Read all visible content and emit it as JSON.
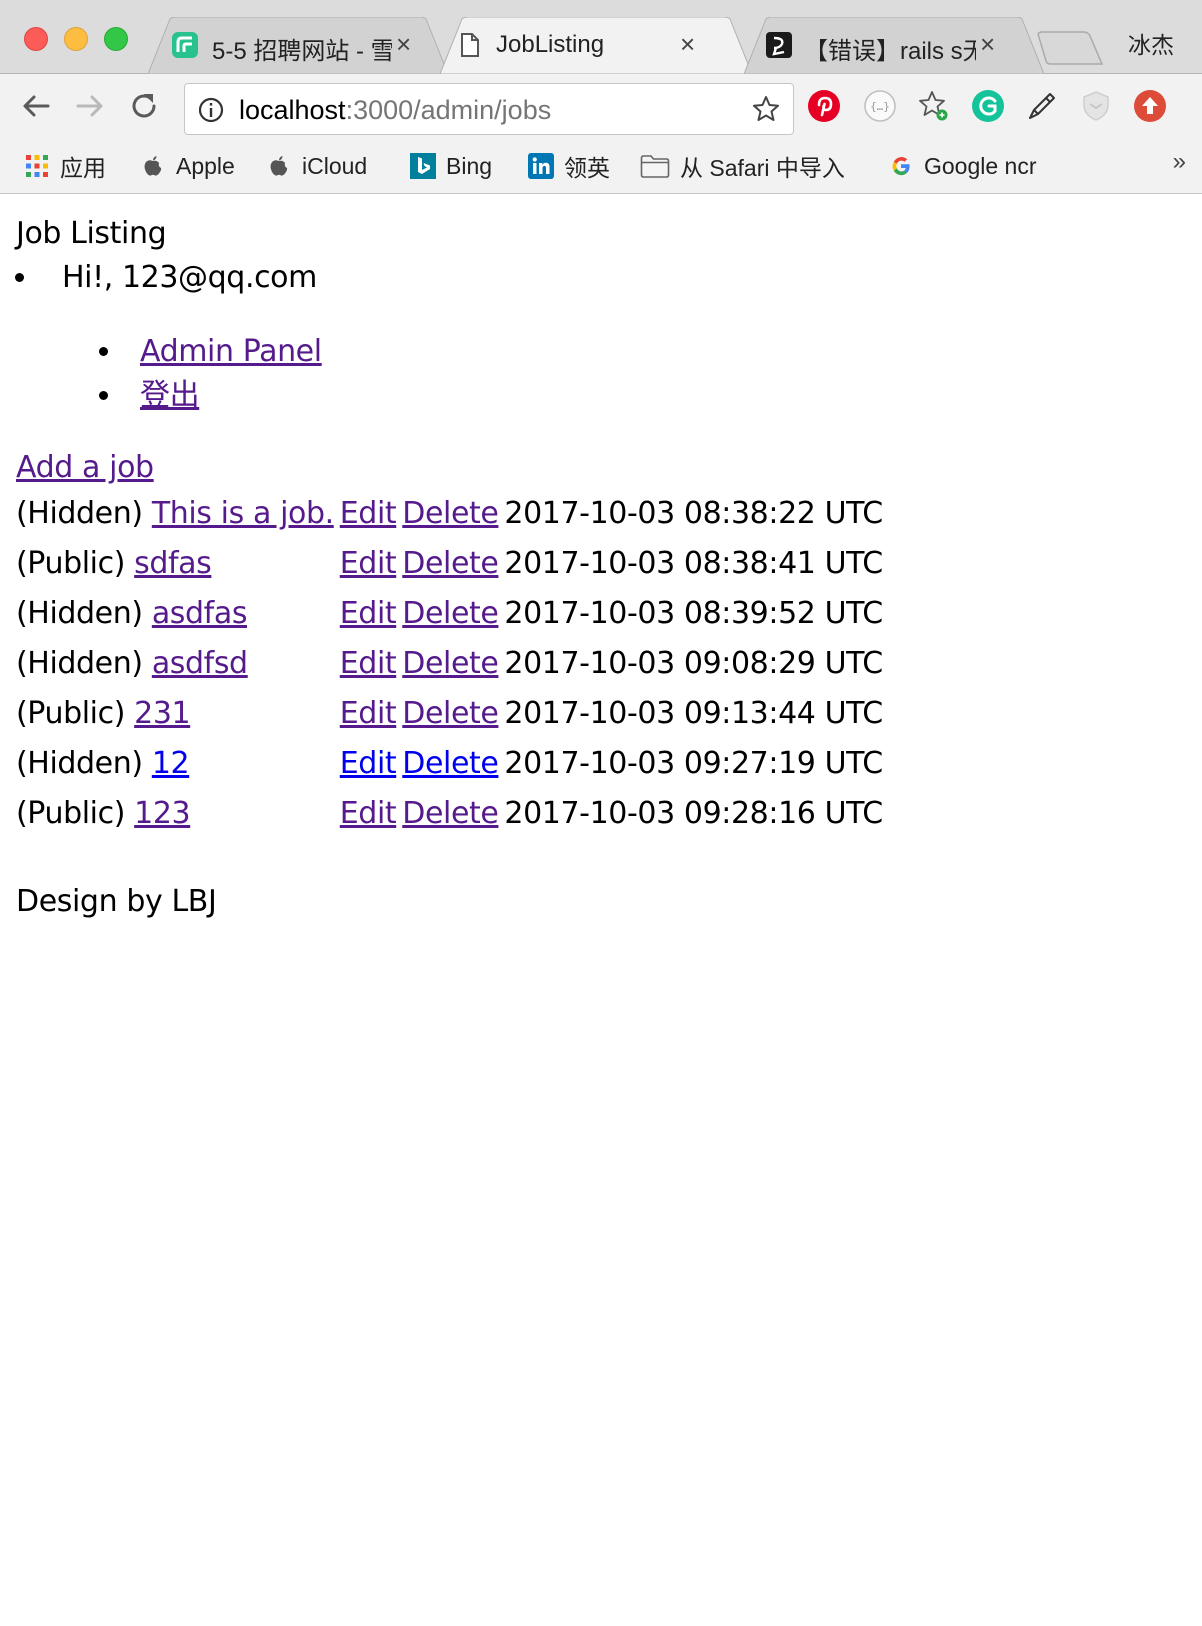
{
  "browser": {
    "profile_name": "冰杰",
    "tabs": [
      {
        "title": "5-5 招聘网站 - 雪",
        "favicon": "green-logo-icon",
        "active": false
      },
      {
        "title": "JobListing",
        "favicon": "page-icon",
        "active": true
      },
      {
        "title": "【错误】rails s无",
        "favicon": "black-logo-icon",
        "active": false
      }
    ],
    "address": {
      "host": "localhost",
      "path": ":3000/admin/jobs"
    },
    "bookmarks": [
      {
        "label": "应用",
        "icon": "apps-grid-icon"
      },
      {
        "label": "Apple",
        "icon": "apple-icon"
      },
      {
        "label": "iCloud",
        "icon": "apple-icon"
      },
      {
        "label": "Bing",
        "icon": "bing-icon"
      },
      {
        "label": "领英",
        "icon": "linkedin-icon"
      },
      {
        "label": "从 Safari 中导入",
        "icon": "folder-icon"
      },
      {
        "label": "Google ncr",
        "icon": "google-icon"
      }
    ],
    "more_label": "»"
  },
  "page": {
    "app_title": "Job Listing",
    "greeting": "Hi!, 123@qq.com",
    "admin_panel": "Admin Panel",
    "logout": "登出",
    "add_job": "Add a job",
    "edit_label": "Edit",
    "delete_label": "Delete",
    "jobs": [
      {
        "status": "(Hidden)",
        "title": "This is a job.",
        "created": "2017-10-03 08:38:22 UTC",
        "visited": true
      },
      {
        "status": "(Public)",
        "title": "sdfas",
        "created": "2017-10-03 08:38:41 UTC",
        "visited": true
      },
      {
        "status": "(Hidden)",
        "title": "asdfas",
        "created": "2017-10-03 08:39:52 UTC",
        "visited": true
      },
      {
        "status": "(Hidden)",
        "title": "asdfsd",
        "created": "2017-10-03 09:08:29 UTC",
        "visited": true
      },
      {
        "status": "(Public)",
        "title": "231",
        "created": "2017-10-03 09:13:44 UTC",
        "visited": true
      },
      {
        "status": "(Hidden)",
        "title": "12",
        "created": "2017-10-03 09:27:19 UTC",
        "visited": false
      },
      {
        "status": "(Public)",
        "title": "123",
        "created": "2017-10-03 09:28:16 UTC",
        "visited": true
      }
    ],
    "footer": "Design by LBJ"
  },
  "colors": {
    "visited_link": "#551a8b",
    "unvisited_link": "#0000ee"
  }
}
